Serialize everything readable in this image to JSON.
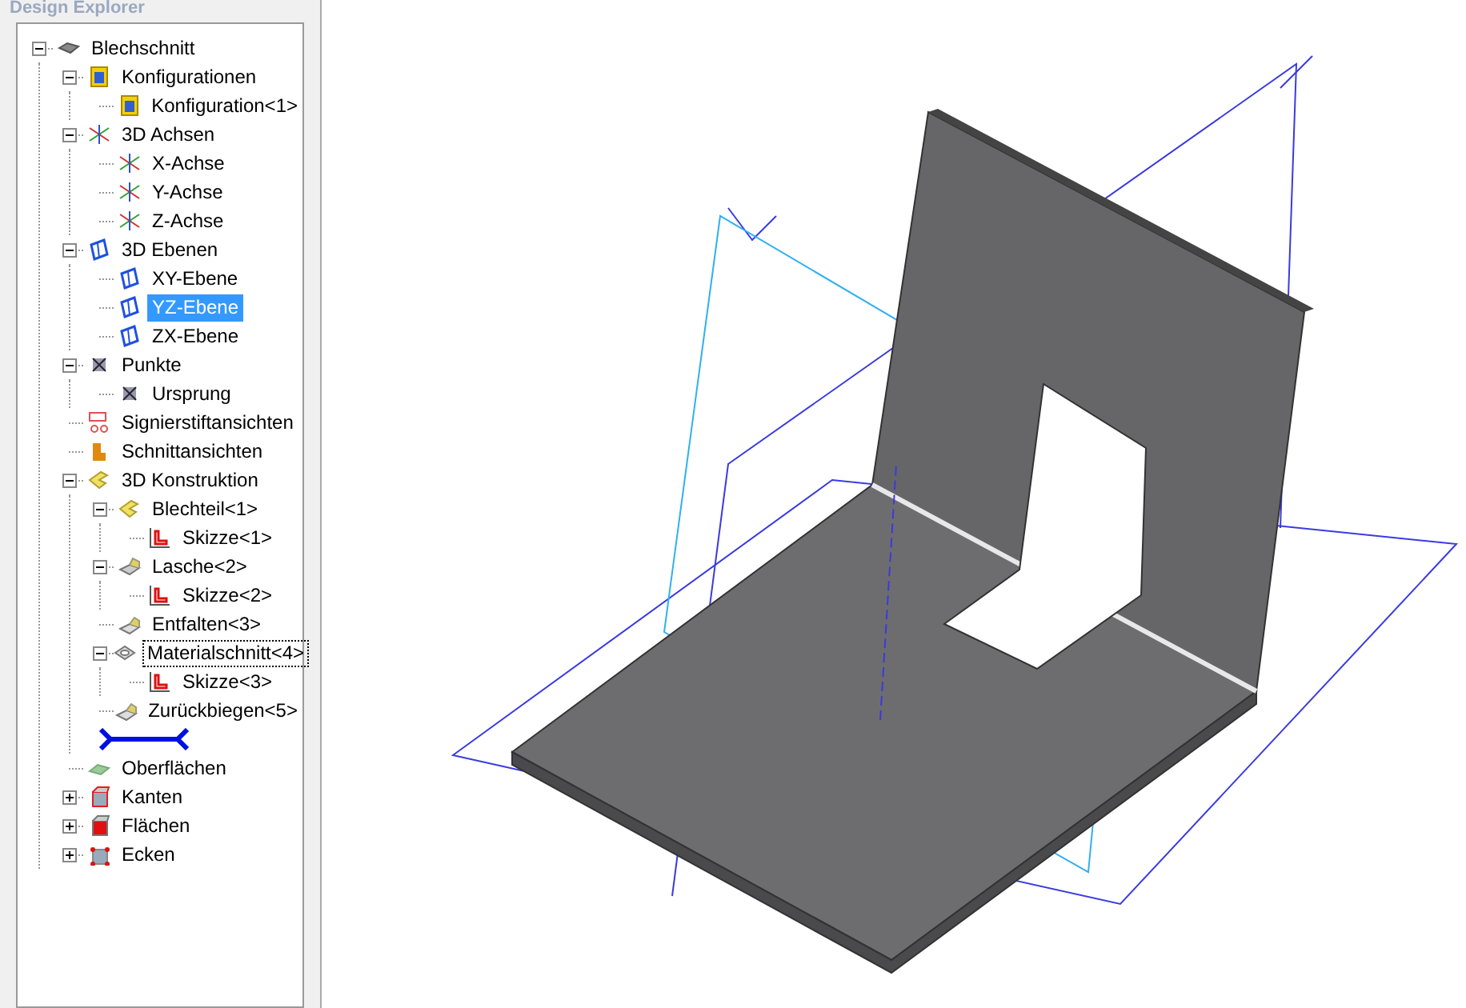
{
  "panel": {
    "title": "Design Explorer"
  },
  "tree": [
    {
      "label": "Blechschnitt",
      "kind": "body",
      "expanded": true,
      "selected": false,
      "focused": false,
      "children": [
        {
          "label": "Konfigurationen",
          "kind": "config",
          "expanded": true,
          "selected": false,
          "focused": false,
          "children": [
            {
              "label": "Konfiguration<1>",
              "kind": "config",
              "selected": false,
              "focused": false
            }
          ]
        },
        {
          "label": "3D Achsen",
          "kind": "axes",
          "expanded": true,
          "selected": false,
          "focused": false,
          "children": [
            {
              "label": "X-Achse",
              "kind": "axes",
              "selected": false,
              "focused": false
            },
            {
              "label": "Y-Achse",
              "kind": "axes",
              "selected": false,
              "focused": false
            },
            {
              "label": "Z-Achse",
              "kind": "axes",
              "selected": false,
              "focused": false
            }
          ]
        },
        {
          "label": "3D Ebenen",
          "kind": "plane",
          "expanded": true,
          "selected": false,
          "focused": false,
          "children": [
            {
              "label": "XY-Ebene",
              "kind": "plane",
              "selected": false,
              "focused": false
            },
            {
              "label": "YZ-Ebene",
              "kind": "plane",
              "selected": true,
              "focused": false
            },
            {
              "label": "ZX-Ebene",
              "kind": "plane",
              "selected": false,
              "focused": false
            }
          ]
        },
        {
          "label": "Punkte",
          "kind": "point",
          "expanded": true,
          "selected": false,
          "focused": false,
          "children": [
            {
              "label": "Ursprung",
              "kind": "point",
              "selected": false,
              "focused": false
            }
          ]
        },
        {
          "label": "Signierstiftansichten",
          "kind": "marker",
          "selected": false,
          "focused": false
        },
        {
          "label": "Schnittansichten",
          "kind": "section",
          "selected": false,
          "focused": false
        },
        {
          "label": "3D Konstruktion",
          "kind": "construct",
          "expanded": true,
          "selected": false,
          "focused": false,
          "children": [
            {
              "label": "Blechteil<1>",
              "kind": "construct",
              "expanded": true,
              "selected": false,
              "focused": false,
              "children": [
                {
                  "label": "Skizze<1>",
                  "kind": "sketch",
                  "selected": false,
                  "focused": false
                }
              ]
            },
            {
              "label": "Lasche<2>",
              "kind": "flange",
              "expanded": true,
              "selected": false,
              "focused": false,
              "children": [
                {
                  "label": "Skizze<2>",
                  "kind": "sketch",
                  "selected": false,
                  "focused": false
                }
              ]
            },
            {
              "label": "Entfalten<3>",
              "kind": "unfold",
              "selected": false,
              "focused": false
            },
            {
              "label": "Materialschnitt<4>",
              "kind": "cut",
              "expanded": true,
              "selected": false,
              "focused": true,
              "children": [
                {
                  "label": "Skizze<3>",
                  "kind": "sketch",
                  "selected": false,
                  "focused": false
                }
              ]
            },
            {
              "label": "Zurückbiegen<5>",
              "kind": "unfold",
              "selected": false,
              "focused": false
            },
            {
              "kind": "rollback"
            }
          ]
        },
        {
          "label": "Oberflächen",
          "kind": "surfaces",
          "selected": false,
          "focused": false
        },
        {
          "label": "Kanten",
          "kind": "edges",
          "expanded": false,
          "selected": false,
          "focused": false
        },
        {
          "label": "Flächen",
          "kind": "faces",
          "expanded": false,
          "selected": false,
          "focused": false
        },
        {
          "label": "Ecken",
          "kind": "vertices",
          "expanded": false,
          "selected": false,
          "focused": false
        }
      ]
    }
  ]
}
